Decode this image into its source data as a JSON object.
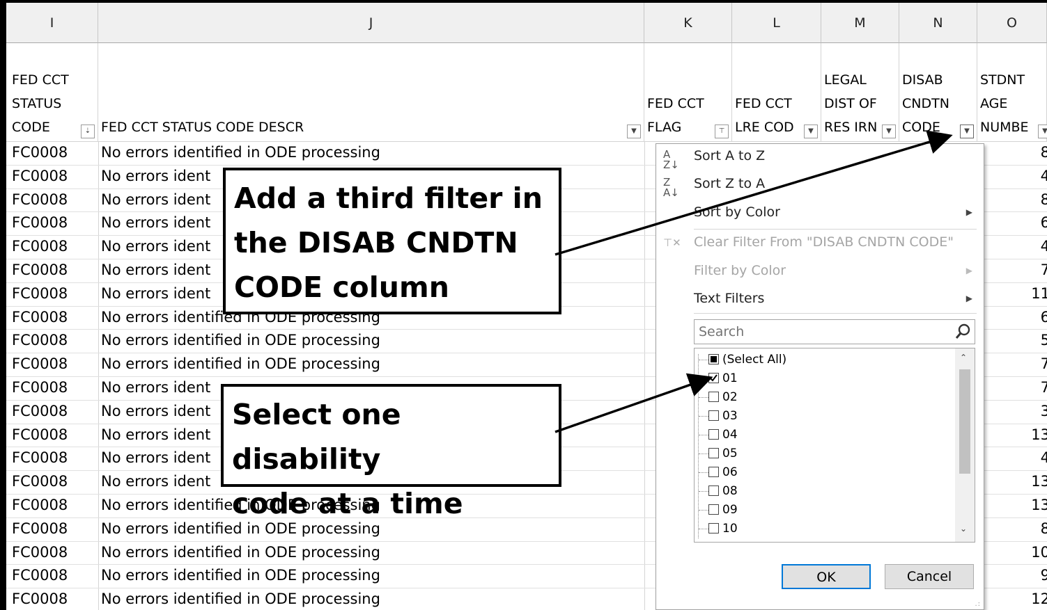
{
  "columns": [
    {
      "letter": "I"
    },
    {
      "letter": "J"
    },
    {
      "letter": "K"
    },
    {
      "letter": "L"
    },
    {
      "letter": "M"
    },
    {
      "letter": "N"
    },
    {
      "letter": "O"
    }
  ],
  "headers": {
    "I": "FED CCT\nSTATUS\nCODE",
    "J": "FED CCT STATUS CODE DESCR",
    "K": "FED CCT\nFLAG",
    "L": "FED CCT\nLRE COD",
    "M": "LEGAL\nDIST OF\nRES IRN",
    "N": "DISAB\nCNDTN\nCODE",
    "O": "STDNT\nAGE\nNUMBE"
  },
  "rows": [
    {
      "code": "FC0008",
      "descr": "No errors identified in ODE processing",
      "age": "8"
    },
    {
      "code": "FC0008",
      "descr": "No errors ident",
      "age": "4"
    },
    {
      "code": "FC0008",
      "descr": "No errors ident",
      "age": "8"
    },
    {
      "code": "FC0008",
      "descr": "No errors ident",
      "age": "6"
    },
    {
      "code": "FC0008",
      "descr": "No errors ident",
      "age": "4"
    },
    {
      "code": "FC0008",
      "descr": "No errors ident",
      "age": "7"
    },
    {
      "code": "FC0008",
      "descr": "No errors ident",
      "age": "11"
    },
    {
      "code": "FC0008",
      "descr": "No errors identified in ODE processing",
      "age": "6"
    },
    {
      "code": "FC0008",
      "descr": "No errors identified in ODE processing",
      "age": "5"
    },
    {
      "code": "FC0008",
      "descr": "No errors identified in ODE processing",
      "age": "7"
    },
    {
      "code": "FC0008",
      "descr": "No errors ident",
      "age": "7"
    },
    {
      "code": "FC0008",
      "descr": "No errors ident",
      "age": "3"
    },
    {
      "code": "FC0008",
      "descr": "No errors ident",
      "age": "13"
    },
    {
      "code": "FC0008",
      "descr": "No errors ident",
      "age": "4"
    },
    {
      "code": "FC0008",
      "descr": "No errors ident",
      "age": "13"
    },
    {
      "code": "FC0008",
      "descr": "No errors identified in ODE processing",
      "age": "13"
    },
    {
      "code": "FC0008",
      "descr": "No errors identified in ODE processing",
      "age": "8"
    },
    {
      "code": "FC0008",
      "descr": "No errors identified in ODE processing",
      "age": "10"
    },
    {
      "code": "FC0008",
      "descr": "No errors identified in ODE processing",
      "age": "9"
    },
    {
      "code": "FC0008",
      "descr": "No errors identified in ODE processing",
      "age": "12"
    }
  ],
  "dropdown": {
    "sort_az": "Sort A to Z",
    "sort_za": "Sort Z to A",
    "sort_color": "Sort by Color",
    "clear_filter": "Clear Filter From \"DISAB CNDTN CODE\"",
    "filter_color": "Filter by Color",
    "text_filters": "Text Filters",
    "search_placeholder": "Search",
    "items": [
      {
        "label": "(Select All)",
        "state": "partial"
      },
      {
        "label": "01",
        "state": "checked"
      },
      {
        "label": "02",
        "state": "unchecked"
      },
      {
        "label": "03",
        "state": "unchecked"
      },
      {
        "label": "04",
        "state": "unchecked"
      },
      {
        "label": "05",
        "state": "unchecked"
      },
      {
        "label": "06",
        "state": "unchecked"
      },
      {
        "label": "08",
        "state": "unchecked"
      },
      {
        "label": "09",
        "state": "unchecked"
      },
      {
        "label": "10",
        "state": "unchecked"
      }
    ],
    "ok": "OK",
    "cancel": "Cancel"
  },
  "callouts": {
    "filter": "Add a third filter in\nthe DISAB CNDTN\nCODE column",
    "select": "Select one disability\ncode at a time"
  }
}
